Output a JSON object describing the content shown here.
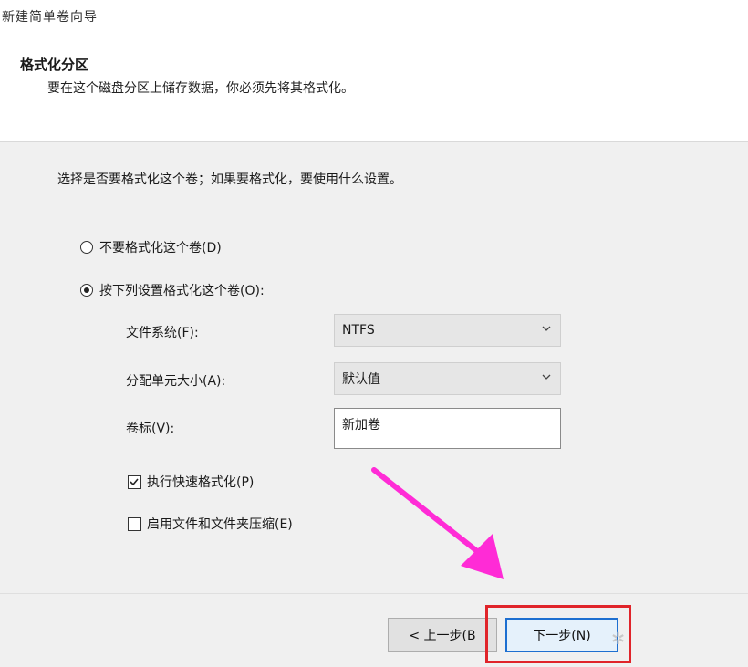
{
  "window": {
    "title_fragment": "新建简单卷向导"
  },
  "header": {
    "title": "格式化分区",
    "subtitle": "要在这个磁盘分区上储存数据，你必须先将其格式化。"
  },
  "content": {
    "instruction": "选择是否要格式化这个卷；如果要格式化，要使用什么设置。",
    "option_no_format": {
      "label": "不要格式化这个卷(D)",
      "selected": false
    },
    "option_format": {
      "label": "按下列设置格式化这个卷(O):",
      "selected": true
    },
    "file_system": {
      "label": "文件系统(F):",
      "value": "NTFS"
    },
    "allocation_unit": {
      "label": "分配单元大小(A):",
      "value": "默认值"
    },
    "volume_label": {
      "label": "卷标(V):",
      "value": "新加卷"
    },
    "quick_format": {
      "label": "执行快速格式化(P)",
      "checked": true
    },
    "compression": {
      "label": "启用文件和文件夹压缩(E)",
      "checked": false
    }
  },
  "footer": {
    "back_label": "< 上一步(B",
    "next_label": "下一步(N)"
  },
  "annotation": {
    "arrow_color": "#ff2bd6",
    "highlight_color": "#e0242a"
  }
}
